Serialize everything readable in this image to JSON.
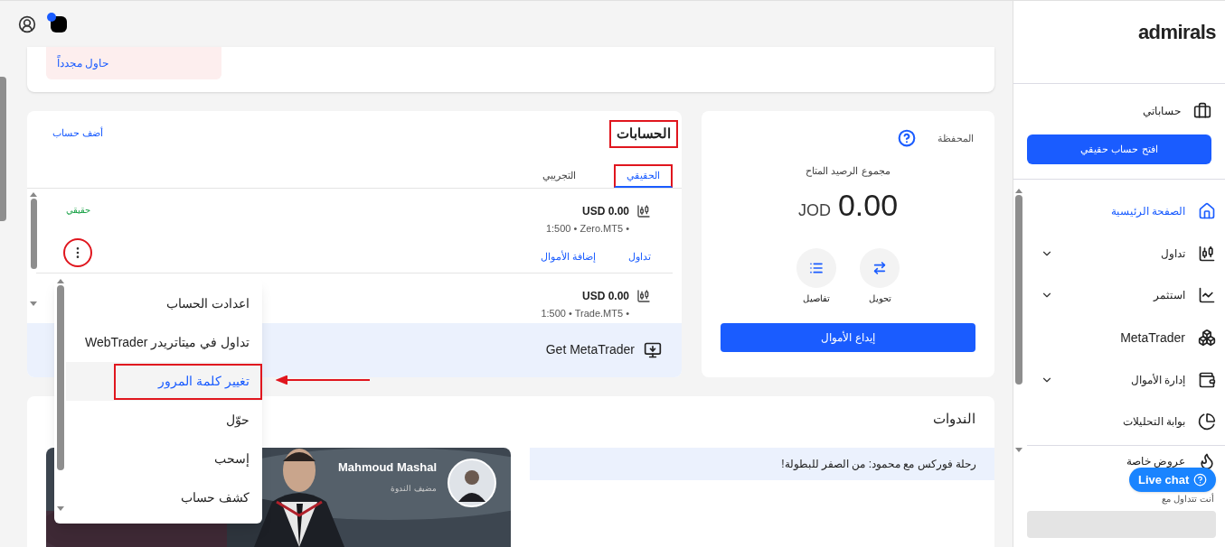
{
  "alert": {
    "action": "حاول مجدداً"
  },
  "accounts": {
    "title": "الحسابات",
    "title_highlighted": true,
    "add_link": "أضف حساب",
    "tabs": [
      {
        "label": "الحقيقي",
        "selected": true,
        "highlighted": true
      },
      {
        "label": "التجريبي",
        "selected": false,
        "highlighted": false
      }
    ],
    "items": [
      {
        "balance": "USD 0.00",
        "details": "1:500 • Zero.MT5 •",
        "status": "حقيقي",
        "actions": [
          "تداول",
          "إضافة الأموال"
        ],
        "menu_button_highlighted": true
      },
      {
        "balance": "USD 0.00",
        "details": "1:500 • Trade.MT5 •"
      }
    ],
    "banner": "Get MetaTrader"
  },
  "menu": [
    {
      "label": "اعدادت الحساب",
      "selected": false,
      "highlighted": false
    },
    {
      "label": "تداول في ميتاتريدر WebTrader",
      "selected": false,
      "highlighted": false
    },
    {
      "label": "تغيير كلمة المرور",
      "selected": true,
      "highlighted": true
    },
    {
      "label": "حوّل",
      "selected": false,
      "highlighted": false
    },
    {
      "label": "إسحب",
      "selected": false,
      "highlighted": false
    },
    {
      "label": "كشف حساب",
      "selected": false,
      "highlighted": false
    }
  ],
  "wallet": {
    "label": "المحفظة",
    "caption": "مجموع الرصيد المتاح",
    "amount": "0.00",
    "currency": "JOD",
    "actions": [
      {
        "label": "تحويل",
        "kind": "transfer"
      },
      {
        "label": "تفاصيل",
        "kind": "details"
      }
    ],
    "deposit": "إيداع الأموال"
  },
  "webinars": {
    "title": "الندوات",
    "session": "رحلة فوركس مع محمود: من الصفر للبطولة!",
    "host_name": "Mahmoud Mashal",
    "host_role": "مضيف الندوة"
  },
  "sidebar": {
    "logo": "admirals",
    "my_accounts": "حساباتي",
    "open_button": "افتح حساب حقيقي",
    "nav": [
      {
        "label": "الصفحة الرئيسية",
        "selected": true,
        "expandable": false
      },
      {
        "label": "تداول",
        "selected": false,
        "expandable": true
      },
      {
        "label": "استثمر",
        "selected": false,
        "expandable": true
      },
      {
        "label": "MetaTrader",
        "selected": false,
        "expandable": false
      },
      {
        "label": "إدارة الأموال",
        "selected": false,
        "expandable": true
      },
      {
        "label": "بوابة التحليلات",
        "selected": false,
        "expandable": false
      }
    ],
    "offers": "عروض خاصة",
    "footer": "أنت تتداول مع",
    "live_chat": "Live chat"
  }
}
